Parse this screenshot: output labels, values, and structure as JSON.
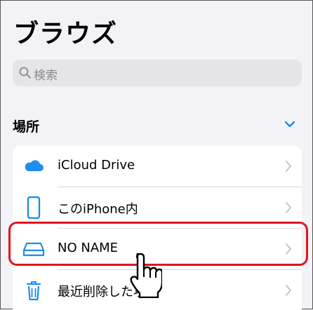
{
  "header": {
    "title": "ブラウズ"
  },
  "search": {
    "placeholder": "検索"
  },
  "locations": {
    "section_title": "場所",
    "items": [
      {
        "label": "iCloud Drive",
        "icon": "icloud-icon"
      },
      {
        "label": "このiPhone内",
        "icon": "iphone-icon"
      },
      {
        "label": "NO NAME",
        "icon": "external-drive-icon"
      },
      {
        "label": "最近削除した項目",
        "icon": "trash-icon"
      }
    ]
  },
  "colors": {
    "accent": "#007aff",
    "highlight": "#e0151f",
    "background": "#f2f2f7"
  }
}
